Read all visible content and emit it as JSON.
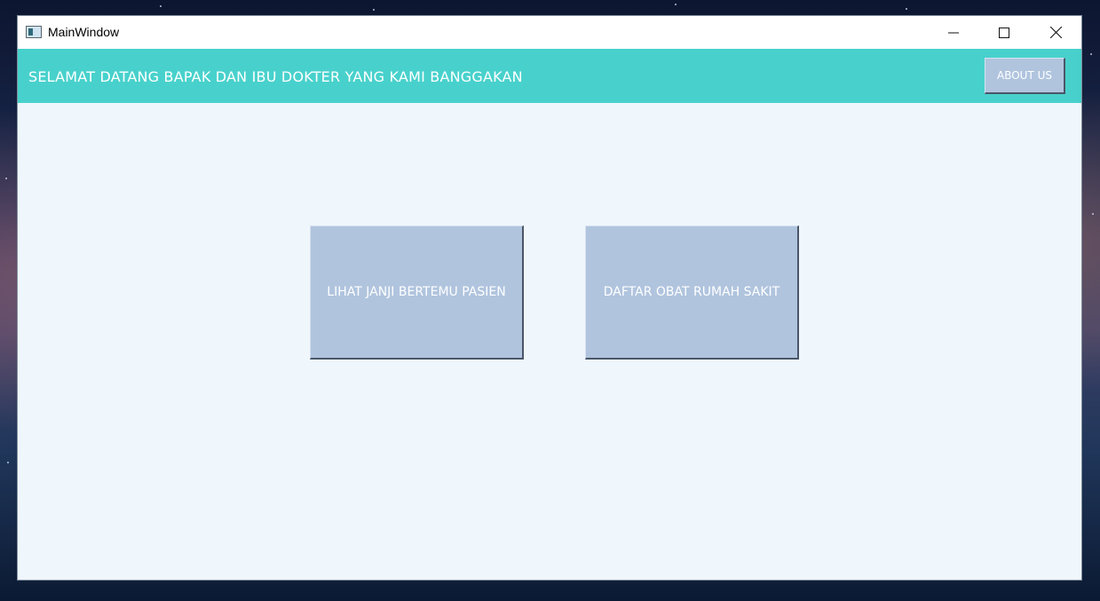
{
  "window": {
    "title": "MainWindow",
    "controls": {
      "minimize": "minimize-icon",
      "maximize": "maximize-icon",
      "close": "close-icon"
    }
  },
  "header": {
    "welcome_text": "SELAMAT DATANG BAPAK DAN IBU DOKTER YANG KAMI BANGGAKAN",
    "about_label": "ABOUT US"
  },
  "main": {
    "buttons": [
      {
        "label": "LIHAT JANJI BERTEMU PASIEN"
      },
      {
        "label": "DAFTAR OBAT RUMAH SAKIT"
      }
    ]
  },
  "colors": {
    "header_bg": "#48d1cc",
    "button_bg": "#b0c4de",
    "content_bg": "#eff7fd",
    "button_text": "#ffffff"
  }
}
